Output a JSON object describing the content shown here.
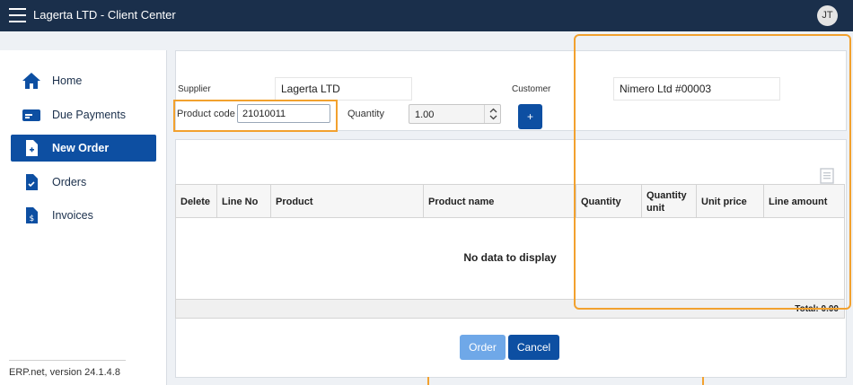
{
  "app": {
    "title": "Lagerta LTD - Client Center",
    "user_initials": "JT"
  },
  "sidebar": {
    "items": [
      {
        "label": "Home",
        "icon": "home-icon"
      },
      {
        "label": "Due Payments",
        "icon": "card-icon"
      },
      {
        "label": "New Order",
        "icon": "new-document-icon",
        "active": true
      },
      {
        "label": "Orders",
        "icon": "orders-document-icon"
      },
      {
        "label": "Invoices",
        "icon": "invoice-document-icon"
      }
    ],
    "version": "ERP.net, version 24.1.4.8"
  },
  "header_form": {
    "supplier_label": "Supplier",
    "supplier_value": "Lagerta LTD",
    "customer_label": "Customer",
    "customer_value": "Nimero Ltd #00003",
    "product_code_label": "Product code",
    "product_code_value": "21010011",
    "quantity_label": "Quantity",
    "quantity_value": "1.00",
    "add_label": "+"
  },
  "grid": {
    "columns": [
      "Delete",
      "Line No",
      "Product",
      "Product name",
      "Quantity",
      "Quantity unit",
      "Unit price",
      "Line amount"
    ],
    "empty_text": "No data to display",
    "total": "Total: 0.00"
  },
  "actions": {
    "order_label": "Order",
    "cancel_label": "Cancel"
  },
  "colors": {
    "topbar": "#1a2f4b",
    "accent": "#0d4fa2",
    "highlight": "#f2a12e",
    "disabled_button": "#6fa8e8"
  }
}
